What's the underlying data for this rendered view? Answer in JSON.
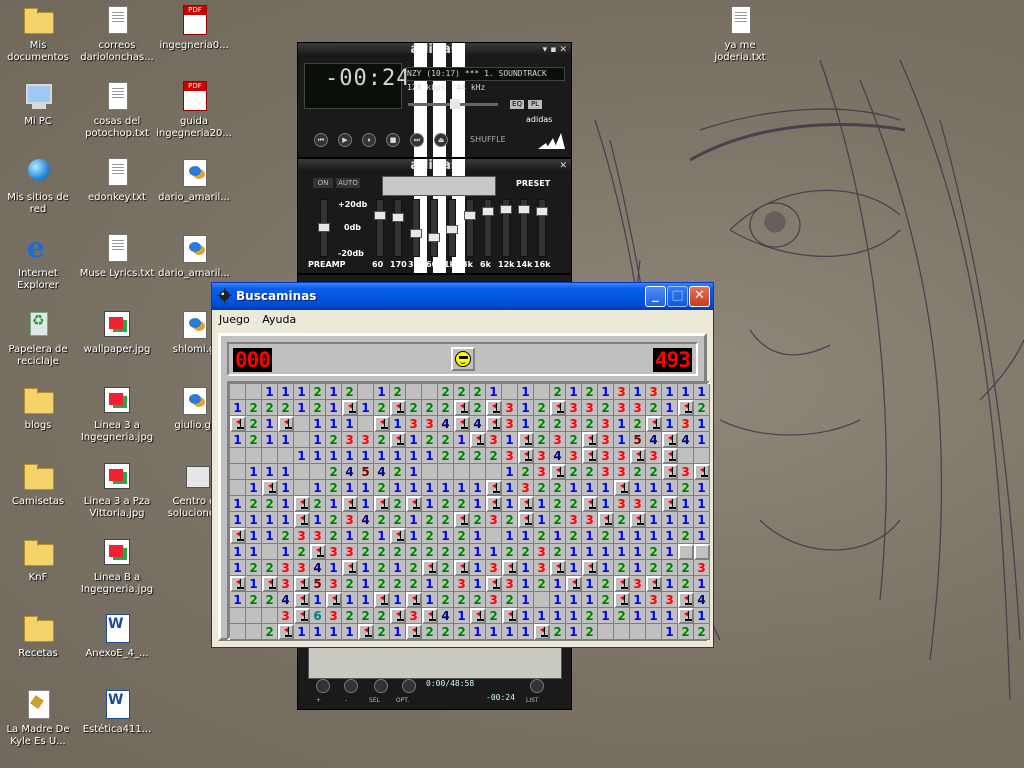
{
  "desktop_icons": [
    {
      "label": "Mis documentos",
      "icon": "folder-docs-icon"
    },
    {
      "label": "Mi PC",
      "icon": "computer-icon"
    },
    {
      "label": "Mis sitios de red",
      "icon": "network-icon"
    },
    {
      "label": "Internet Explorer",
      "icon": "ie-icon"
    },
    {
      "label": "Papelera de reciclaje",
      "icon": "recycle-bin-icon"
    },
    {
      "label": "blogs",
      "icon": "folder-icon"
    },
    {
      "label": "Camisetas",
      "icon": "folder-icon"
    },
    {
      "label": "KnF",
      "icon": "folder-icon"
    },
    {
      "label": "Recetas",
      "icon": "folder-icon"
    },
    {
      "label": "La Madre De Kyle Es U...",
      "icon": "notepad-icon"
    },
    {
      "label": "correos dariolonchas...",
      "icon": "text-file-icon"
    },
    {
      "label": "cosas del potochop.txt",
      "icon": "text-file-icon"
    },
    {
      "label": "edonkey.txt",
      "icon": "text-file-icon"
    },
    {
      "label": "Muse Lyrics.txt",
      "icon": "text-file-icon"
    },
    {
      "label": "wallpaper.jpg",
      "icon": "image-file-icon"
    },
    {
      "label": "Linea 3 a Ingegneria.jpg",
      "icon": "image-file-icon"
    },
    {
      "label": "Linea 3 a Pza Vittoria.jpg",
      "icon": "image-file-icon"
    },
    {
      "label": "Linea B a Ingegneria.jpg",
      "icon": "image-file-icon"
    },
    {
      "label": "AnexoE_4_...",
      "icon": "word-file-icon"
    },
    {
      "label": "Estética411...",
      "icon": "word-file-icon"
    },
    {
      "label": "ingegneria0...",
      "icon": "pdf-file-icon"
    },
    {
      "label": "guida ingegneria20...",
      "icon": "pdf-file-icon"
    },
    {
      "label": "dario_amaril...",
      "icon": "picture-icon"
    },
    {
      "label": "dario_amaril...",
      "icon": "picture-icon"
    },
    {
      "label": "shlomi.g",
      "icon": "picture-icon"
    },
    {
      "label": "giulio.gi",
      "icon": "picture-icon"
    },
    {
      "label": "Centro d soluciones",
      "icon": "shortcut-icon"
    },
    {
      "label": "ya me joderia.txt",
      "icon": "text-file-icon"
    }
  ],
  "winamp": {
    "skin_title": "adidas",
    "time": "-00:24",
    "track": "NZY (10:17) *** 1. SOUNDTRACK",
    "kbps": "128",
    "kbps_unit": "kbps",
    "khz": "44",
    "khz_unit": "kHz",
    "shuffle": "SHUFFLE",
    "eq_btn": "EQ",
    "pl_btn": "PL",
    "brand": "adidas",
    "eq_title": "adidas",
    "eq_on": "ON",
    "eq_auto": "AUTO",
    "eq_preset": "PRESET",
    "db_plus": "+20db",
    "db_zero": "0db",
    "db_minus": "-20db",
    "preamp": "PREAMP",
    "bands": [
      "60",
      "170",
      "310",
      "600",
      "1k",
      "3k",
      "6k",
      "12k",
      "14k",
      "16k"
    ],
    "pl_time": "0:00/48:58",
    "pl_remaining": "-00:24",
    "pl_buttons": [
      "+",
      "-",
      "SEL",
      "OPT.",
      "LIST"
    ]
  },
  "minesweeper": {
    "title": "Buscaminas",
    "menu": [
      "Juego",
      "Ayuda"
    ],
    "mines_left": "000",
    "timer": "493",
    "rows": [
      "00111212012002221010212131311112121",
      "1222121F12F222F2F312F3323321F2212",
      "F21F01110F1334F4F312232312F131111",
      "1211012332F1221F31F232F3154F4111",
      "000011111111122223F343F33F3F0021",
      "01110024542100000123F223322F3F31",
      "01F1012112111111F1322111F11121",
      "1221F21F1F2F1221F1F122F1332F1111",
      "1111F123422122F232F1233F2F1111",
      "F112332121F1212101121212111121",
      "11012F3322222221122321111121",
      "1223341F1212F2F13F13F1F1212223F21",
      "F1F3F53212221231F3121F12F3F121",
      "1224F1F11F1F122232101112F133F4F",
      "0003F63222F3F41F2F1111212111F11",
      "002F1111F21F2221111F2120000122"
    ]
  }
}
